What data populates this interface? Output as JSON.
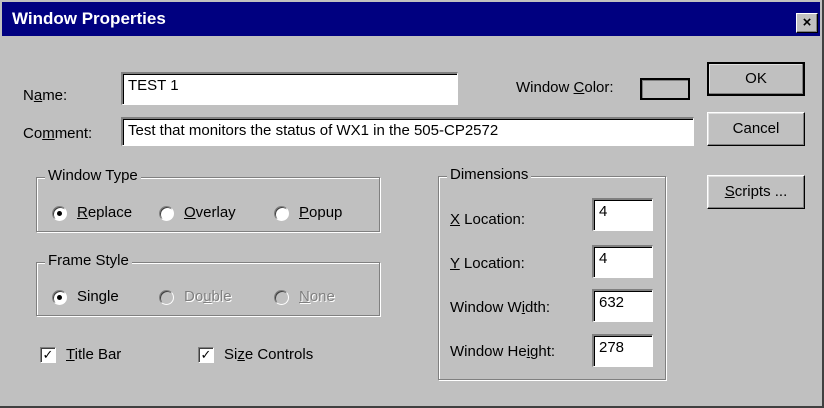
{
  "window": {
    "title": "Window Properties",
    "close_glyph": "×"
  },
  "fields": {
    "name": {
      "label_pre": "N",
      "label_mn": "a",
      "label_post": "me:",
      "value": "TEST 1"
    },
    "comment": {
      "label_pre": "Co",
      "label_mn": "m",
      "label_post": "ment:",
      "value": "Test that monitors the status of WX1 in the 505-CP2572"
    },
    "window_color": {
      "label_pre": "Window ",
      "label_mn": "C",
      "label_post": "olor:"
    }
  },
  "buttons": {
    "ok": "OK",
    "cancel": "Cancel",
    "scripts_mn": "S",
    "scripts_post": "cripts ..."
  },
  "window_type": {
    "title": "Window Type",
    "options": [
      {
        "mn": "R",
        "post": "eplace",
        "selected": true
      },
      {
        "mn": "O",
        "post": "verlay",
        "selected": false
      },
      {
        "mn": "P",
        "post": "opup",
        "selected": false
      }
    ]
  },
  "frame_style": {
    "title": "Frame Style",
    "options": [
      {
        "pre": "Single",
        "selected": true,
        "enabled": true
      },
      {
        "pre": "Do",
        "mn": "u",
        "post": "ble",
        "selected": false,
        "enabled": false
      },
      {
        "mn": "N",
        "post": "one",
        "selected": false,
        "enabled": false
      }
    ]
  },
  "checkboxes": {
    "title_bar": {
      "mn": "T",
      "post": "itle Bar",
      "checked": true
    },
    "size_controls": {
      "pre": "Si",
      "mn": "z",
      "post": "e Controls",
      "checked": true
    }
  },
  "dimensions": {
    "title": "Dimensions",
    "x": {
      "mn": "X",
      "post": " Location:",
      "value": "4"
    },
    "y": {
      "mn": "Y",
      "post": " Location:",
      "value": "4"
    },
    "width": {
      "pre": "Window W",
      "mn": "i",
      "post": "dth:",
      "value": "632"
    },
    "height": {
      "pre": "Window He",
      "mn": "i",
      "post": "ght:",
      "value": "278"
    }
  },
  "colors": {
    "face": "#c0c0c0",
    "titlebar": "#000080",
    "title_text": "#ffffff"
  }
}
